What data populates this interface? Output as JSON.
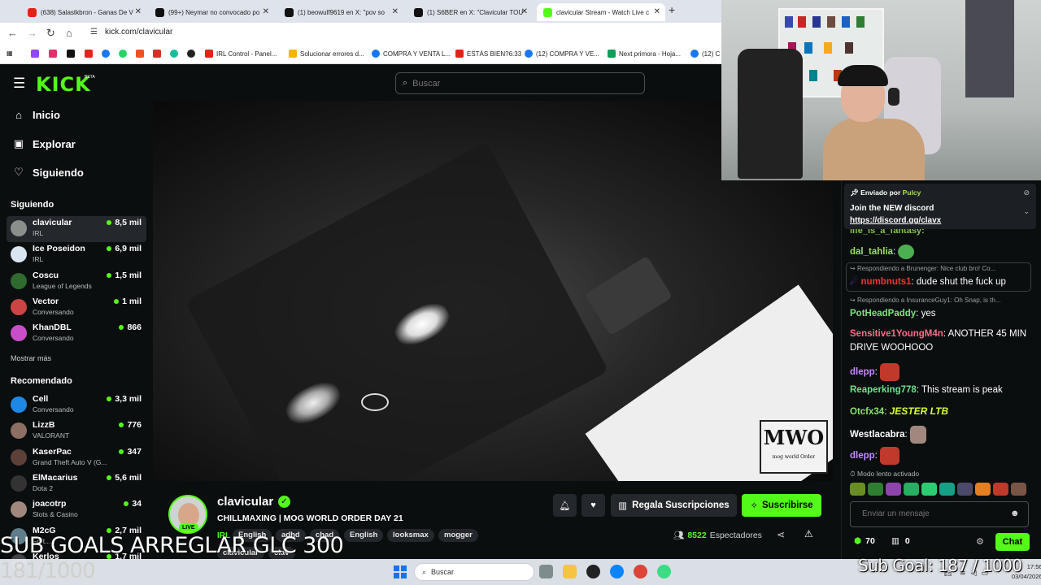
{
  "browser": {
    "tabs": [
      {
        "title": "(638) Salastkbron - Ganas De V",
        "color": "#e62117"
      },
      {
        "title": "(99+) Neymar no convocado po",
        "color": "#111111"
      },
      {
        "title": "(1) beowulf9619 en X: \"pov so",
        "color": "#111111"
      },
      {
        "title": "(1) S6BER en X: \"Clavicular TOU",
        "color": "#111111"
      },
      {
        "title": "clavicular Stream - Watch Live c",
        "color": "#53fc18"
      }
    ],
    "url": "kick.com/clavicular",
    "bookmarks": [
      {
        "label": "IRL Control - Panel...",
        "color": "#e62117"
      },
      {
        "label": "Solucionar errores d...",
        "color": "#f4b400"
      },
      {
        "label": "COMPRA Y VENTA L...",
        "color": "#1877f2"
      },
      {
        "label": "ESTÁS BIEN?6:33",
        "color": "#e62117"
      },
      {
        "label": "(12) COMPRA Y VE...",
        "color": "#1877f2"
      },
      {
        "label": "Next primora - Hoja...",
        "color": "#0f9d58"
      },
      {
        "label": "(12) C",
        "color": "#1877f2"
      }
    ]
  },
  "header": {
    "logo": "KICK",
    "logo_badge": "BETA",
    "search_placeholder": "Buscar"
  },
  "sidebar": {
    "nav": [
      {
        "label": "Inicio",
        "icon": "home-icon",
        "glyph": "⌂"
      },
      {
        "label": "Explorar",
        "icon": "compass-icon",
        "glyph": "▣"
      },
      {
        "label": "Siguiendo",
        "icon": "heart-icon",
        "glyph": "♡"
      }
    ],
    "following_title": "Siguiendo",
    "following": [
      {
        "name": "clavicular",
        "category": "IRL",
        "viewers": "8,5 mil",
        "avatar": "#8a8f8c"
      },
      {
        "name": "Ice Poseidon",
        "category": "IRL",
        "viewers": "6,9 mil",
        "avatar": "#d9e6f2"
      },
      {
        "name": "Coscu",
        "category": "League of Legends",
        "viewers": "1,5 mil",
        "avatar": "#2f6b2f"
      },
      {
        "name": "Vector",
        "category": "Conversando",
        "viewers": "1 mil",
        "avatar": "#c44"
      },
      {
        "name": "KhanDBL",
        "category": "Conversando",
        "viewers": "866",
        "avatar": "#c94fc9"
      }
    ],
    "show_more": "Mostrar más",
    "recommended_title": "Recomendado",
    "recommended": [
      {
        "name": "Cell",
        "category": "Conversando",
        "viewers": "3,3 mil",
        "avatar": "#1e88e5"
      },
      {
        "name": "LizzB",
        "category": "VALORANT",
        "viewers": "776",
        "avatar": "#8d6e63"
      },
      {
        "name": "KaserPac",
        "category": "Grand Theft Auto V (G...",
        "viewers": "347",
        "avatar": "#5d4037"
      },
      {
        "name": "ElMacarius",
        "category": "Dota 2",
        "viewers": "5,6 mil",
        "avatar": "#333"
      },
      {
        "name": "joacotrp",
        "category": "Slots & Casino",
        "viewers": "34",
        "avatar": "#a1887f"
      },
      {
        "name": "M2cG",
        "category": "Fort...",
        "viewers": "2,7 mil",
        "avatar": "#607d8b"
      },
      {
        "name": "Kerlos",
        "category": "",
        "viewers": "1,7 mil",
        "avatar": "#444"
      }
    ]
  },
  "stream": {
    "overlay_logo_big": "MWO",
    "overlay_logo_small": "mog world Order",
    "streamer": "clavicular",
    "live_badge": "LIVE",
    "title": "CHILLMAXING | MOG WORLD ORDER DAY 21",
    "category": "IRL",
    "tags": [
      "English",
      "adhd",
      "chad",
      "English",
      "looksmax",
      "mogger"
    ],
    "tags_row2": [
      "clavicular",
      "clav"
    ],
    "gift_label": "Regala Suscripciones",
    "subscribe_label": "Suscribirse",
    "viewers": "8522",
    "viewers_label": "Espectadores"
  },
  "chat": {
    "pinned": {
      "sent_by": "Enviado por",
      "user": "Pulcy",
      "message": "Join the NEW discord",
      "link": "https://discord.gg/clavx"
    },
    "partial_top": "life_is_a_fantasy:",
    "messages": [
      {
        "user": "dal_tahlia",
        "color": "#9be15d",
        "text": "",
        "emote": "#4caf50"
      },
      {
        "user": "numbnuts1",
        "color": "#e53935",
        "text": "dude shut the fuck up",
        "reply": "Respondiendo a Brunenger: Nice club bro! Co..."
      },
      {
        "user": "PotHeadPaddy",
        "color": "#7ee07e",
        "text": "yes",
        "reply": "Respondiendo a InsuranceGuy1: Oh Snap, is th..."
      },
      {
        "user": "Sensitive1YoungM4n",
        "color": "#ff6b8a",
        "text": "ANOTHER 45 MIN DRIVE WOOHOOO"
      },
      {
        "user": "dlepp",
        "color": "#c58bff",
        "text": "",
        "emote": "#c0392b"
      },
      {
        "user": "Reaperking778",
        "color": "#6ee08a",
        "text": "This stream is peak"
      },
      {
        "user": "Otcfx34",
        "color": "#8be36d",
        "text": "",
        "emote_text": "JESTER LTB"
      },
      {
        "user": "Westlacabra",
        "color": "#ffffff",
        "text": "",
        "emote": "#a1887f"
      },
      {
        "user": "dlepp",
        "color": "#c58bff",
        "text": "",
        "emote": "#c0392b"
      }
    ],
    "slow_mode": "Modo lento activado",
    "input_placeholder": "Enviar un mensaje",
    "points": "70",
    "gifts": "0",
    "chat_button": "Chat"
  },
  "overlays": {
    "sub_goals": "SUB GOALS ARREGLAR GLC  300",
    "count": "181/1000",
    "sub_goal_text": "Sub Goal: 187 / 1000"
  },
  "taskbar": {
    "search": "Buscar",
    "lang": "ES",
    "time": "17:56",
    "date": "03/04/2026"
  }
}
